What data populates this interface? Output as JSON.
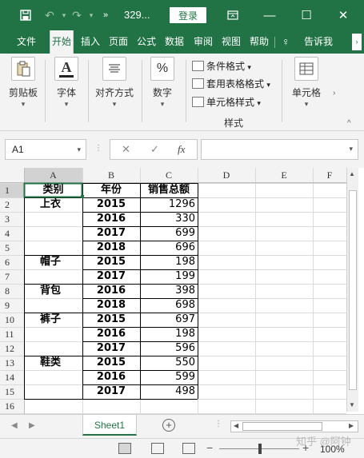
{
  "app": {
    "filename": "329...",
    "login_label": "登录"
  },
  "tabs": [
    "文件",
    "开始",
    "插入",
    "页面",
    "公式",
    "数据",
    "审阅",
    "视图",
    "帮助",
    "告诉我"
  ],
  "active_tab": "开始",
  "ribbon": {
    "clipboard": "剪贴板",
    "font": "字体",
    "font_icon": "A",
    "alignment": "对齐方式",
    "number": "数字",
    "number_icon": "%",
    "styles_items": [
      "条件格式",
      "套用表格格式",
      "单元格样式"
    ],
    "styles_label": "样式",
    "cells": "单元格"
  },
  "formula_bar": {
    "name_box": "A1",
    "cancel_icon": "✕",
    "enter_icon": "✓",
    "fx_label": "fx",
    "value": ""
  },
  "grid": {
    "columns": [
      "A",
      "B",
      "C",
      "D",
      "E",
      "F"
    ],
    "header": [
      "类别",
      "年份",
      "销售总额"
    ],
    "rows": [
      {
        "num": "2",
        "cat": "上衣",
        "year": "2015",
        "sales": "1296"
      },
      {
        "num": "3",
        "cat": "",
        "year": "2016",
        "sales": "330"
      },
      {
        "num": "4",
        "cat": "",
        "year": "2017",
        "sales": "699"
      },
      {
        "num": "5",
        "cat": "",
        "year": "2018",
        "sales": "696"
      },
      {
        "num": "6",
        "cat": "帽子",
        "year": "2015",
        "sales": "198"
      },
      {
        "num": "7",
        "cat": "",
        "year": "2017",
        "sales": "199"
      },
      {
        "num": "8",
        "cat": "背包",
        "year": "2016",
        "sales": "398"
      },
      {
        "num": "9",
        "cat": "",
        "year": "2018",
        "sales": "698"
      },
      {
        "num": "10",
        "cat": "裤子",
        "year": "2015",
        "sales": "697"
      },
      {
        "num": "11",
        "cat": "",
        "year": "2016",
        "sales": "198"
      },
      {
        "num": "12",
        "cat": "",
        "year": "2017",
        "sales": "596"
      },
      {
        "num": "13",
        "cat": "鞋类",
        "year": "2015",
        "sales": "550"
      },
      {
        "num": "14",
        "cat": "",
        "year": "2016",
        "sales": "599"
      },
      {
        "num": "15",
        "cat": "",
        "year": "2017",
        "sales": "498"
      }
    ],
    "header_row_num": "1",
    "last_row_num": "16"
  },
  "sheet_tab": "Sheet1",
  "status": {
    "zoom": "100%"
  },
  "watermark": "知乎 @阿钟",
  "colors": {
    "accent": "#217346"
  }
}
